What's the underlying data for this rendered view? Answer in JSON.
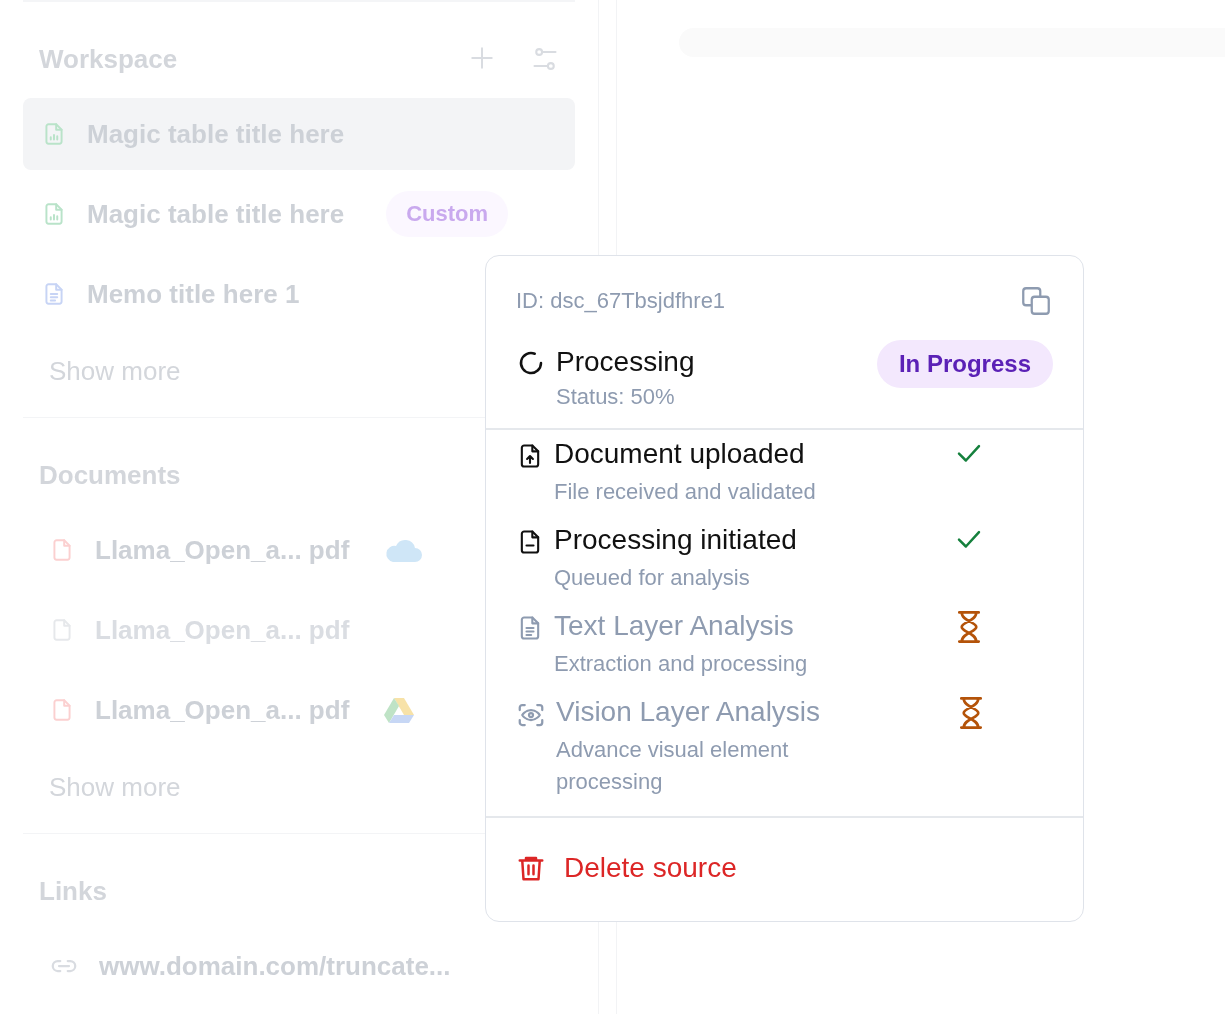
{
  "sidebar": {
    "sections": [
      {
        "title": "Workspace",
        "items": [
          {
            "kind": "table",
            "label": "Magic table title here",
            "selected": true
          },
          {
            "kind": "table",
            "label": "Magic table title here",
            "badge": "Custom",
            "selected": false
          },
          {
            "kind": "memo",
            "label": "Memo title here 1",
            "selected": false
          }
        ],
        "more": "Show more"
      },
      {
        "title": "Documents",
        "items": [
          {
            "kind": "pdf-cloud",
            "label": "Llama_Open_a... pdf",
            "disabled": false
          },
          {
            "kind": "pdf",
            "label": "Llama_Open_a... pdf",
            "disabled": true
          },
          {
            "kind": "pdf-drive",
            "label": "Llama_Open_a... pdf",
            "disabled": false
          }
        ],
        "more": "Show more"
      },
      {
        "title": "Links",
        "items": [
          {
            "kind": "link",
            "label": "www.domain.com/truncate..."
          }
        ]
      }
    ]
  },
  "popover": {
    "id": "ID: dsc_67Tbsjdfhre1",
    "status_title": "Processing",
    "status_detail": "Status: 50%",
    "badge": "In Progress",
    "steps": [
      {
        "kind": "upload",
        "title": "Document uploaded",
        "detail": "File received and validated",
        "completed": true
      },
      {
        "kind": "queue",
        "title": "Processing initiated",
        "detail": "Queued for analysis",
        "completed": true
      },
      {
        "kind": "text",
        "title": "Text Layer Analysis",
        "detail": "Extraction and processing",
        "completed": false
      },
      {
        "kind": "vision",
        "title": "Vision Layer Analysis",
        "detail": "Advance visual element processing",
        "completed": false
      }
    ],
    "delete": "Delete source"
  }
}
